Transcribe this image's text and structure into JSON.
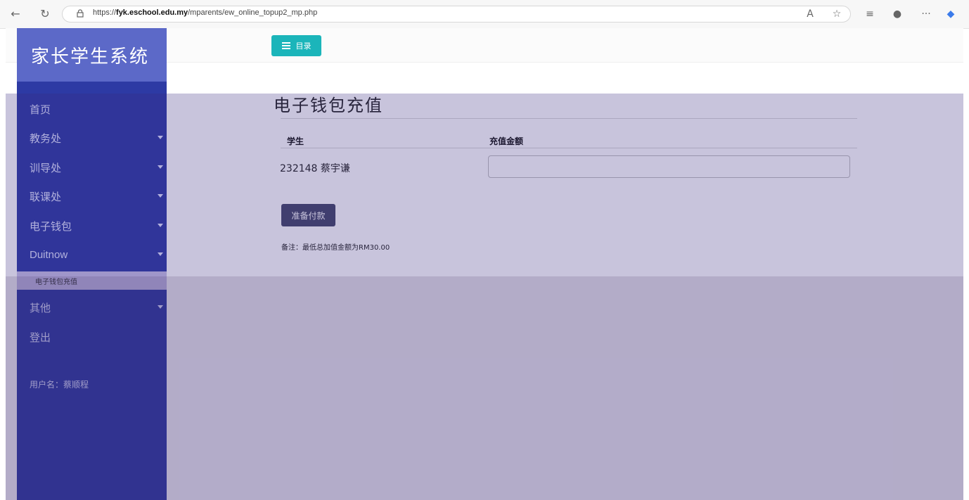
{
  "browser": {
    "url_prefix": "https://",
    "url_domain": "fyk.eschool.edu.my",
    "url_path": "/mparents/ew_online_topup2_mp.php",
    "more_label": "···"
  },
  "app": {
    "brand": "家长学生系统",
    "menu_button_label": "目录"
  },
  "sidebar": {
    "items": [
      {
        "label": "首页"
      },
      {
        "label": "教务处"
      },
      {
        "label": "训导处"
      },
      {
        "label": "联课处"
      },
      {
        "label": "电子钱包"
      },
      {
        "label": "Duitnow"
      },
      {
        "label": "电子钱包充值"
      },
      {
        "label": "其他"
      },
      {
        "label": "登出"
      }
    ],
    "username": "用户名：蔡顺程"
  },
  "main": {
    "title": "电子钱包充值",
    "table": {
      "headers": [
        "学生",
        "充值金额"
      ],
      "rows": [
        {
          "student": "232148 蔡宇谦",
          "amount": ""
        }
      ]
    },
    "prepare_button": "准备付款",
    "note": "备注：最低总加值金额为RM30.00"
  },
  "colors": {
    "sidebar_bg": "#2d3aa4",
    "brand_bg": "#5c69c8",
    "menu_button_bg": "#1bb5ba",
    "prepare_button_bg": "#434668"
  }
}
